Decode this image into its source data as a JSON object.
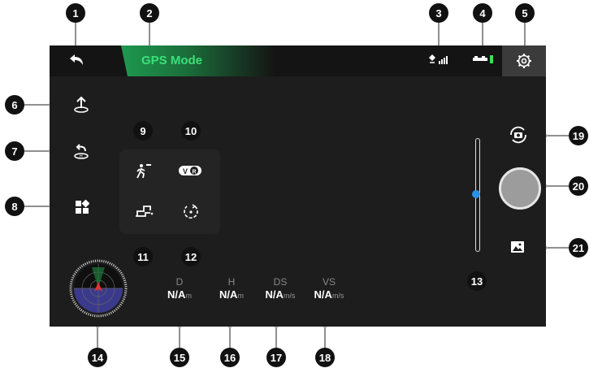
{
  "header": {
    "mode_label": "GPS Mode"
  },
  "telemetry": [
    {
      "label": "D",
      "value": "N/A",
      "unit": "m"
    },
    {
      "label": "H",
      "value": "N/A",
      "unit": "m"
    },
    {
      "label": "DS",
      "value": "N/A",
      "unit": "m/s"
    },
    {
      "label": "VS",
      "value": "N/A",
      "unit": "m/s"
    }
  ],
  "callouts": [
    "1",
    "2",
    "3",
    "4",
    "5",
    "6",
    "7",
    "8",
    "9",
    "10",
    "11",
    "12",
    "13",
    "14",
    "15",
    "16",
    "17",
    "18",
    "19",
    "20",
    "21"
  ],
  "icons": {
    "back": "back-arrow-icon",
    "signal": "gps-signal-icon",
    "battery": "battery-icon",
    "settings": "gear-icon",
    "takeoff": "takeoff-icon",
    "return_home": "return-home-icon",
    "more": "apps-grid-icon",
    "follow": "follow-me-icon",
    "vr": "vr-icon",
    "waypoint": "waypoint-icon",
    "orbit": "orbit-icon",
    "camera_switch": "camera-switch-icon",
    "album": "album-icon",
    "attitude": "attitude-indicator-icon"
  },
  "colors": {
    "accent_green": "#3ce07a",
    "slider_blue": "#2d8ee8",
    "screen_bg": "#1d1d1d",
    "battery_green": "#3cdc5a"
  }
}
